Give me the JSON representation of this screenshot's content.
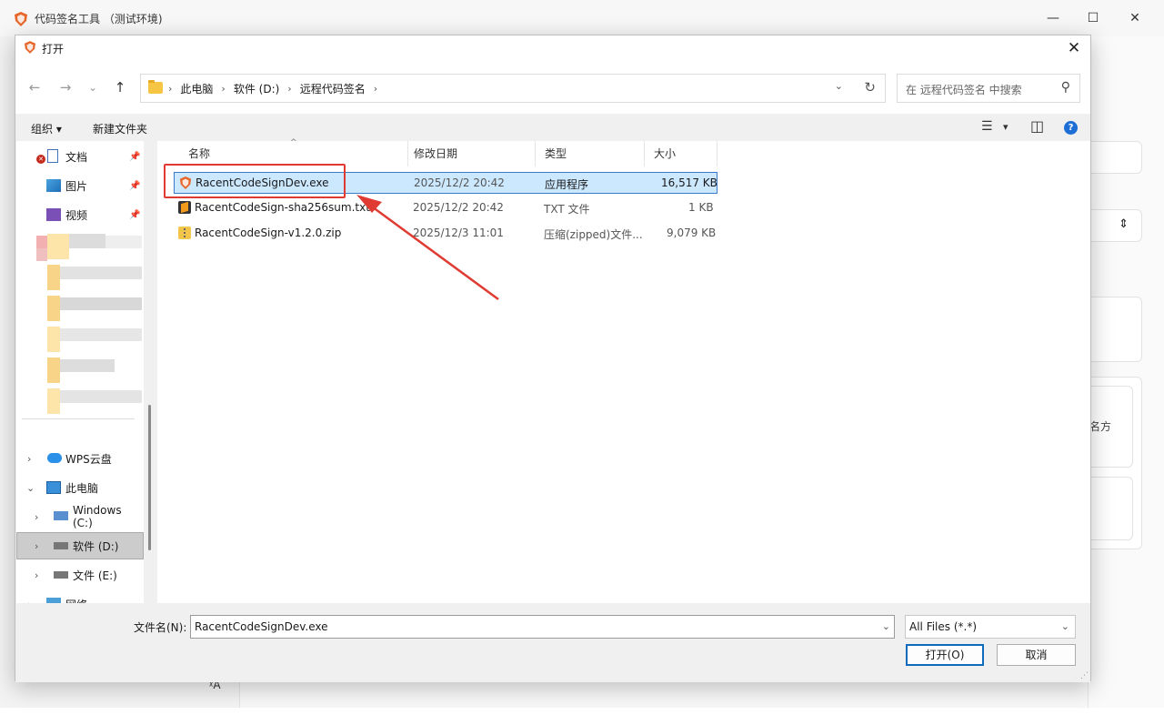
{
  "app": {
    "title": "代码签名工具 （测试环境)",
    "side_text": "名方",
    "lang_icon": "ᵡA"
  },
  "dialog": {
    "title": "打开",
    "close_glyph": "✕",
    "nav": {
      "back": "←",
      "forward": "→",
      "recent": "⌄",
      "up": "↑"
    },
    "breadcrumbs": [
      "此电脑",
      "软件 (D:)",
      "远程代码签名"
    ],
    "crumb_sep": "›",
    "addr_dropdown": "⌄",
    "refresh": "↻",
    "search_placeholder": "在 远程代码签名 中搜索",
    "search_glyph": "⚲",
    "toolbar": {
      "organize": "组织 ▾",
      "new_folder": "新建文件夹",
      "view_glyph": "☰",
      "view_drop": "▾",
      "preview_glyph": "◫",
      "help_glyph": "?"
    },
    "sidebar": {
      "quick_access": [
        {
          "label": "文档",
          "pin": "📌"
        },
        {
          "label": "图片",
          "pin": "📌"
        },
        {
          "label": "视频",
          "pin": "📌"
        }
      ],
      "tree": [
        {
          "label": "WPS云盘",
          "chev": "›"
        },
        {
          "label": "此电脑",
          "chev": "⌄"
        },
        {
          "label": "Windows (C:)",
          "chev": "›"
        },
        {
          "label": "软件 (D:)",
          "chev": "›"
        },
        {
          "label": "文件 (E:)",
          "chev": "›"
        },
        {
          "label": "网络",
          "chev": "›"
        }
      ]
    },
    "columns": {
      "name": "名称",
      "modified": "修改日期",
      "type": "类型",
      "size": "大小",
      "sort_arrow": "^"
    },
    "files": [
      {
        "name": "RacentCodeSignDev.exe",
        "modified": "2025/12/2 20:42",
        "type": "应用程序",
        "size": "16,517 KB",
        "selected": true
      },
      {
        "name": "RacentCodeSign-sha256sum.txt",
        "modified": "2025/12/2 20:42",
        "type": "TXT 文件",
        "size": "1 KB",
        "selected": false
      },
      {
        "name": "RacentCodeSign-v1.2.0.zip",
        "modified": "2025/12/3 11:01",
        "type": "压缩(zipped)文件...",
        "size": "9,079 KB",
        "selected": false
      }
    ],
    "filename_label": "文件名(N):",
    "filename_value": "RacentCodeSignDev.exe",
    "filter_value": "All Files (*.*)",
    "open_button": "打开(O)",
    "cancel_button": "取消",
    "colors": {
      "selection_bg": "#cce8ff",
      "selection_border": "#3a7ac9",
      "annotation_red": "#e03b32",
      "primary_blue": "#0f6cbd"
    }
  }
}
